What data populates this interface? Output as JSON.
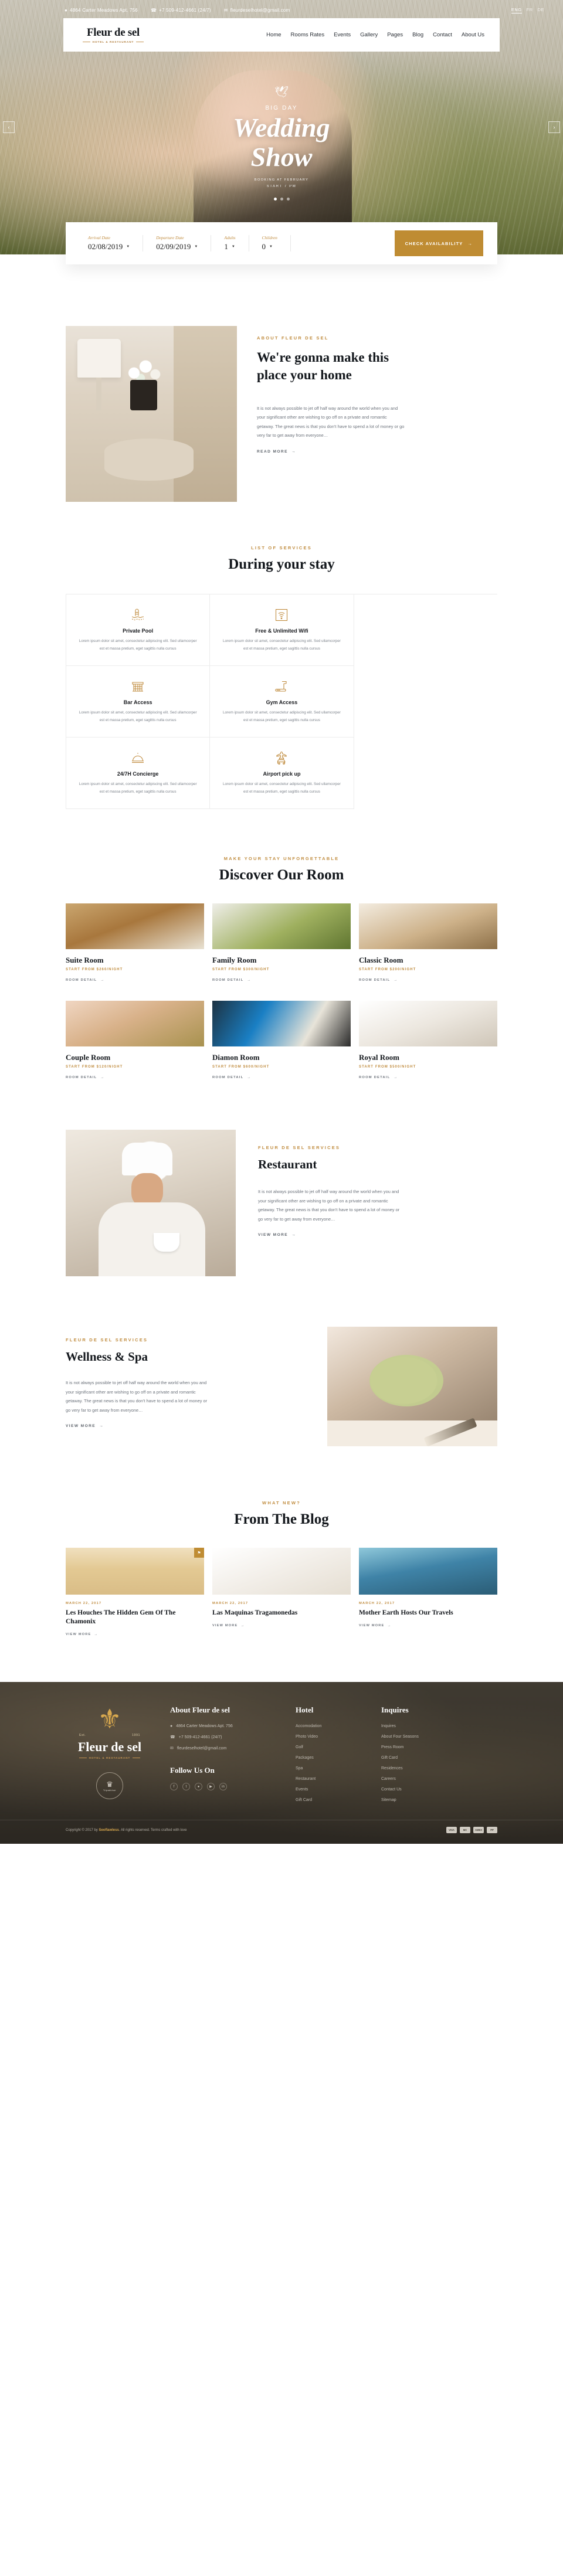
{
  "topbar": {
    "address": "4864 Carter Meadows Apt. 756",
    "phone": "+7 509-412-4661 (24/7)",
    "email": "fleurdeselhotel@gmail.com",
    "languages": [
      "ENG",
      "FR",
      "DE"
    ],
    "active_language": "ENG",
    "icons": {
      "location": "location-pin-icon",
      "phone": "phone-icon",
      "mail": "envelope-icon"
    }
  },
  "brand": {
    "name": "Fleur de sel",
    "tagline": "HOTEL & RESTAURANT"
  },
  "nav": {
    "items": [
      "Home",
      "Rooms Rates",
      "Events",
      "Gallery",
      "Pages",
      "Blog",
      "Contact",
      "About Us"
    ]
  },
  "hero": {
    "kicker": "BIG DAY",
    "title_line1": "Wedding",
    "title_line2": "Show",
    "subtitle": "BOOKING AT FEBRUARY",
    "time": "START 7 PM",
    "prev_arrow": "‹",
    "next_arrow": "›",
    "dove_icon": "dove-icon",
    "slide_count": 3,
    "active_slide": 1
  },
  "booking": {
    "fields": [
      {
        "label": "Arrival Date",
        "value": "02/08/2019"
      },
      {
        "label": "Departure Date",
        "value": "02/09/2019"
      },
      {
        "label": "Adults",
        "value": "1"
      },
      {
        "label": "Children",
        "value": "0"
      }
    ],
    "button": "CHECK AVAILABILITY",
    "button_arrow": "→",
    "accent": "#bf8c33"
  },
  "about": {
    "kicker": "ABOUT FLEUR DE SEL",
    "title": "We're gonna make this place your home",
    "paragraph": "It is not always possible to jet off half way around the world when you and your significant other are wishing to go off on a private and romantic getaway. The great news is that you don't have to spend a lot of money or go very far to get away from everyone…",
    "bold_word": "your",
    "read_more": "READ MORE",
    "arrow": "→"
  },
  "services": {
    "kicker": "LIST OF SERVICES",
    "title": "During your stay",
    "items": [
      {
        "icon": "pool-icon",
        "glyph": "⛱",
        "title": "Private Pool",
        "desc": "Lorem ipsum dolor sit amet, consectetur adipiscing elit. Sed ullamcorper est et massa pretium, eget sagittis nulla cursus"
      },
      {
        "icon": "wifi-icon",
        "glyph": "▽",
        "title": "Free & Unlimited Wifi",
        "desc": "Lorem ipsum dolor sit amet, consectetur adipiscing elit. Sed ullamcorper est et massa pretium, eget sagittis nulla cursus"
      },
      {
        "icon": "bar-icon",
        "glyph": "☰",
        "title": "Bar Access",
        "desc": "Lorem ipsum dolor sit amet, consectetur adipiscing elit. Sed ullamcorper est et massa pretium, eget sagittis nulla cursus"
      },
      {
        "icon": "treadmill-icon",
        "glyph": "⛳",
        "title": "Gym Access",
        "desc": "Lorem ipsum dolor sit amet, consectetur adipiscing elit. Sed ullamcorper est et massa pretium, eget sagittis nulla cursus"
      },
      {
        "icon": "bell-icon",
        "glyph": "⌂",
        "title": "24/7H Concierge",
        "desc": "Lorem ipsum dolor sit amet, consectetur adipiscing elit. Sed ullamcorper est et massa pretium, eget sagittis nulla cursus"
      },
      {
        "icon": "airplane-car-icon",
        "glyph": "✈",
        "title": "Airport pick up",
        "desc": "Lorem ipsum dolor sit amet, consectetur adipiscing elit. Sed ullamcorper est et massa pretium, eget sagittis nulla cursus"
      }
    ]
  },
  "rooms": {
    "kicker": "MAKE YOUR STAY UNFORGETTABLE",
    "title": "Discover Our Room",
    "detail_label": "ROOM DETAIL",
    "arrow": "→",
    "items": [
      {
        "name": "Suite Room",
        "price": "START FROM $260/NIGHT",
        "img": "img-suite"
      },
      {
        "name": "Family Room",
        "price": "START FROM $300/NIGHT",
        "img": "img-family"
      },
      {
        "name": "Classic Room",
        "price": "START FROM $200/NIGHT",
        "img": "img-classic"
      },
      {
        "name": "Couple Room",
        "price": "START FROM $120/NIGHT",
        "img": "img-couple"
      },
      {
        "name": "Diamon Room",
        "price": "START FROM $600/NIGHT",
        "img": "img-diamon"
      },
      {
        "name": "Royal Room",
        "price": "START FROM $500/NIGHT",
        "img": "img-royal"
      }
    ]
  },
  "restaurant": {
    "kicker": "FLEUR DE SEL SERVICES",
    "title": "Restaurant",
    "paragraph": "It is not always possible to jet off half way around the world when you and your significant other are wishing to go off on a private and romantic getaway. The great news is that you don't have to spend a lot of money or go very far to get away from everyone…",
    "read_more": "VIEW MORE",
    "arrow": "→"
  },
  "spa": {
    "kicker": "FLEUR DE SEL SERVICES",
    "title": "Wellness & Spa",
    "paragraph": "It is not always possible to jet off half way around the world when you and your significant other are wishing to go off on a private and romantic getaway. The great news is that you don't have to spend a lot of money or go very far to get away from everyone…",
    "read_more": "VIEW MORE",
    "arrow": "→"
  },
  "blog": {
    "kicker": "WHAT NEW?",
    "title": "From The Blog",
    "read_label": "VIEW MORE",
    "arrow": "→",
    "badge_icon": "bookmark-icon",
    "badge_glyph": "⚑",
    "posts": [
      {
        "date": "MARCH 22, 2017",
        "title": "Les Houches The Hidden Gem Of The Chamonix",
        "img": "img-beach",
        "badge": true
      },
      {
        "date": "MARCH 22, 2017",
        "title": "Las Maquinas Tragamonedas",
        "img": "img-food",
        "badge": false
      },
      {
        "date": "MARCH 22, 2017",
        "title": "Mother Earth Hosts Our Travels",
        "img": "img-pool",
        "badge": false
      }
    ]
  },
  "footer": {
    "brand_icon": "fleur-de-lis-icon",
    "brand_glyph": "⚜",
    "est_left": "Est.",
    "est_right": "1991",
    "brand_name": "Fleur de sel",
    "brand_tagline": "HOTEL & RESTAURANT",
    "award_icon": "trophy-icon",
    "award_glyph": "♛",
    "award_label": "Tripadvisor",
    "about_heading": "About Fleur de sel",
    "contact": {
      "address": "4864 Carter Meadows Apt. 756",
      "phone": "+7 509-412-4661 (24/7)",
      "email": "fleurdeselhotel@gmail.com"
    },
    "follow_heading": "Follow Us On",
    "socials": [
      "f",
      "t",
      "●",
      "▶",
      "in"
    ],
    "columns": [
      {
        "heading": "Hotel",
        "links": [
          "Accomodation",
          "Photo Video",
          "Golf",
          "Packages",
          "Spa",
          "Restaurant",
          "Events",
          "Gift Card"
        ]
      },
      {
        "heading": "Inquires",
        "links": [
          "Inquires",
          "About Four Seasons",
          "Press Room",
          "Gift Card",
          "Residences",
          "Careers",
          "Contact Us",
          "Sitemap"
        ]
      }
    ],
    "copyright_prefix": "Copyright © 2017 by ",
    "copyright_brand": "Seoflawless",
    "copyright_suffix": ". All rights reserved. Terms crafted with love",
    "payments": [
      "VISA",
      "MC",
      "AMEX",
      "PP"
    ]
  }
}
